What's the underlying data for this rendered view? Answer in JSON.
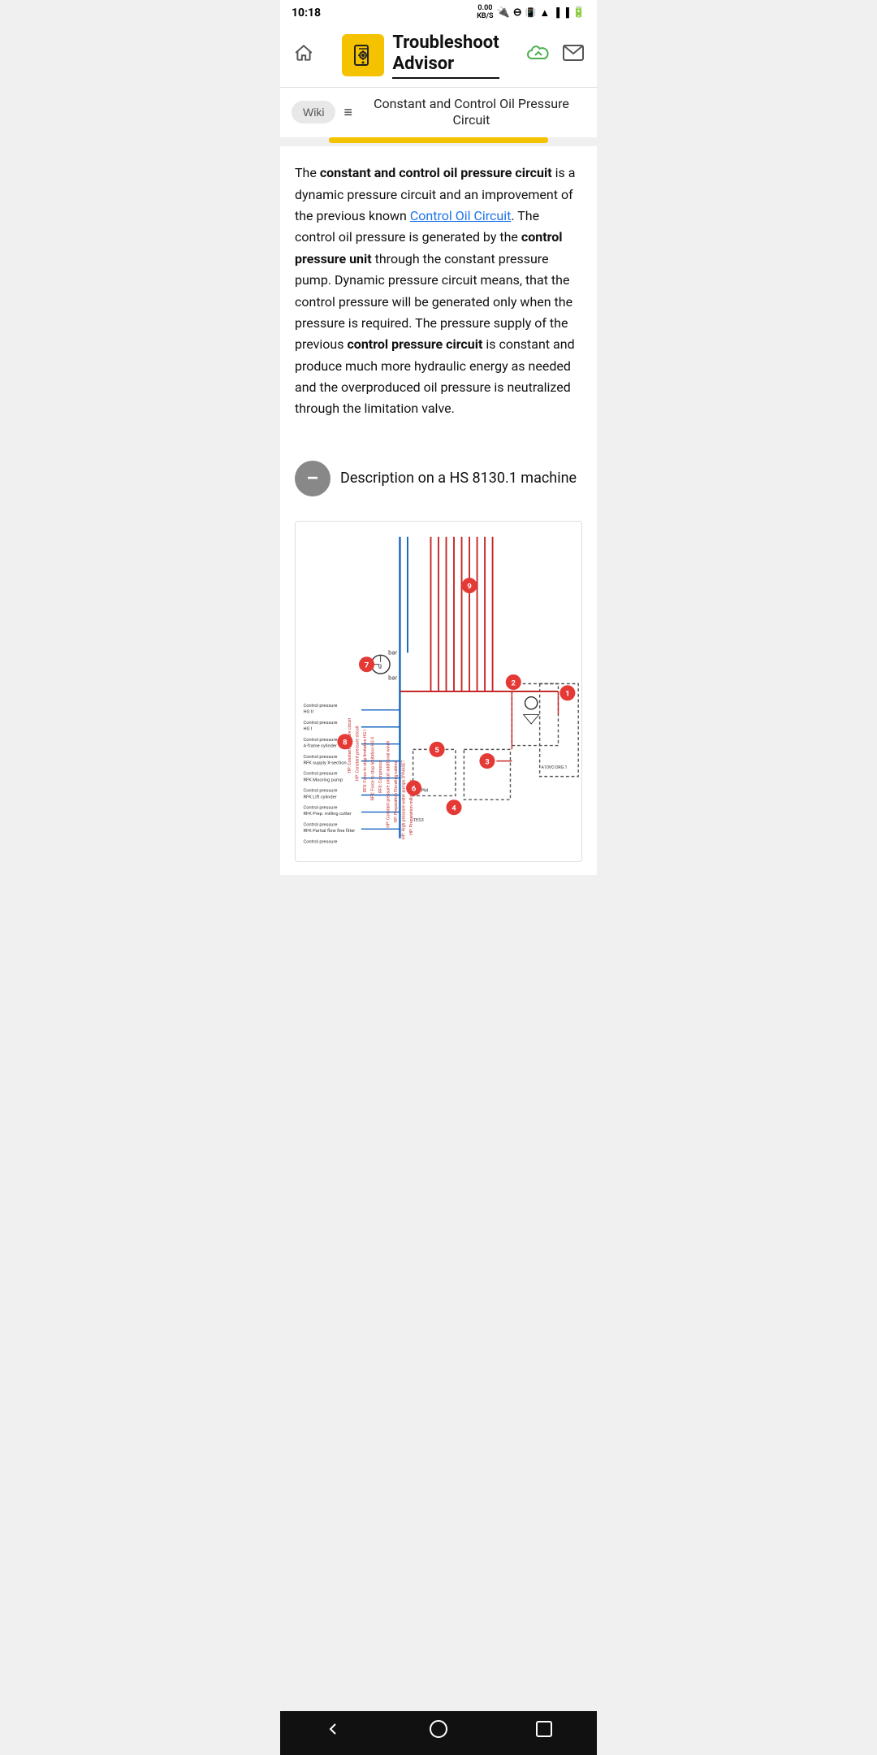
{
  "status": {
    "time": "10:18",
    "speed": "0.00\nKB/S"
  },
  "header": {
    "title_line1": "Troubleshoot",
    "title_line2": "Advisor",
    "home_label": "home",
    "cloud_label": "cloud-sync",
    "mail_label": "mail"
  },
  "page_title_bar": {
    "wiki_label": "Wiki",
    "menu_label": "menu",
    "page_title": "Constant and Control Oil Pressure Circuit"
  },
  "article": {
    "intro_text_1": "The ",
    "intro_bold_1": "constant and control oil pressure circuit",
    "intro_text_2": " is a dynamic pressure circuit and an improvement of the previous known ",
    "intro_link": "Control Oil Circuit",
    "intro_text_3": ". The control oil pressure is generated by the ",
    "intro_bold_2": "control pressure unit",
    "intro_text_4": " through the constant pressure pump. Dynamic pressure circuit means, that the control pressure will be generated only when the pressure is required. The pressure supply of the previous ",
    "intro_bold_3": "control pressure circuit",
    "intro_text_5": " is constant and produce much more hydraulic energy as needed and the overproduced oil pressure is neutralized through the limitation valve."
  },
  "section": {
    "collapse_icon": "−",
    "title": "Description on a HS 8130.1 machine"
  },
  "diagram": {
    "badges": [
      "1",
      "2",
      "3",
      "4",
      "5",
      "6",
      "7",
      "8",
      "9"
    ],
    "labels": [
      "Control pressure HG II",
      "Control pressure HG I",
      "Control pressure A-frame cylinder",
      "Control pressure RFK supply X-section",
      "Control pressure RFK Mooring pump",
      "Control pressure RFK Lift cylinder",
      "Control pressure RFK Prep. milling cutter",
      "Control pressure RFK Partial flow fine filter",
      "Control pressure"
    ]
  },
  "navbar": {
    "back_label": "back",
    "home_label": "home",
    "recents_label": "recents"
  }
}
